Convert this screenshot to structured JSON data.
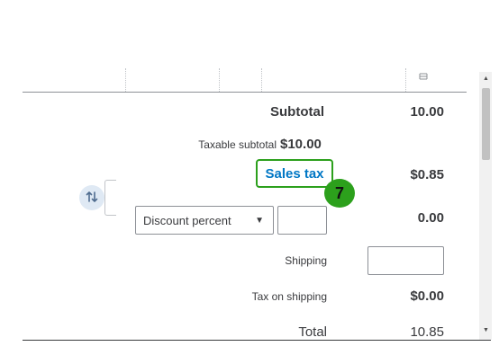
{
  "totals": {
    "subtotal_label": "Subtotal",
    "subtotal_value": "10.00",
    "taxable_subtotal_label": "Taxable subtotal",
    "taxable_subtotal_value": "$10.00",
    "sales_tax_label": "Sales tax",
    "sales_tax_value": "$0.85",
    "discount_select_value": "Discount percent",
    "discount_input_value": "",
    "discount_value": "0.00",
    "shipping_label": "Shipping",
    "shipping_input_value": "",
    "tax_on_shipping_label": "Tax on shipping",
    "tax_on_shipping_value": "$0.00",
    "total_label": "Total",
    "total_value": "10.85"
  },
  "callout": {
    "step_number": "7"
  },
  "icons": {
    "swap": "swap-arrows-icon",
    "dropdown": "chevron-down-icon",
    "column_settings": "column-settings-icon"
  },
  "colors": {
    "accent_green": "#2ca01c",
    "link_blue": "#0077c5",
    "text": "#393a3d"
  }
}
